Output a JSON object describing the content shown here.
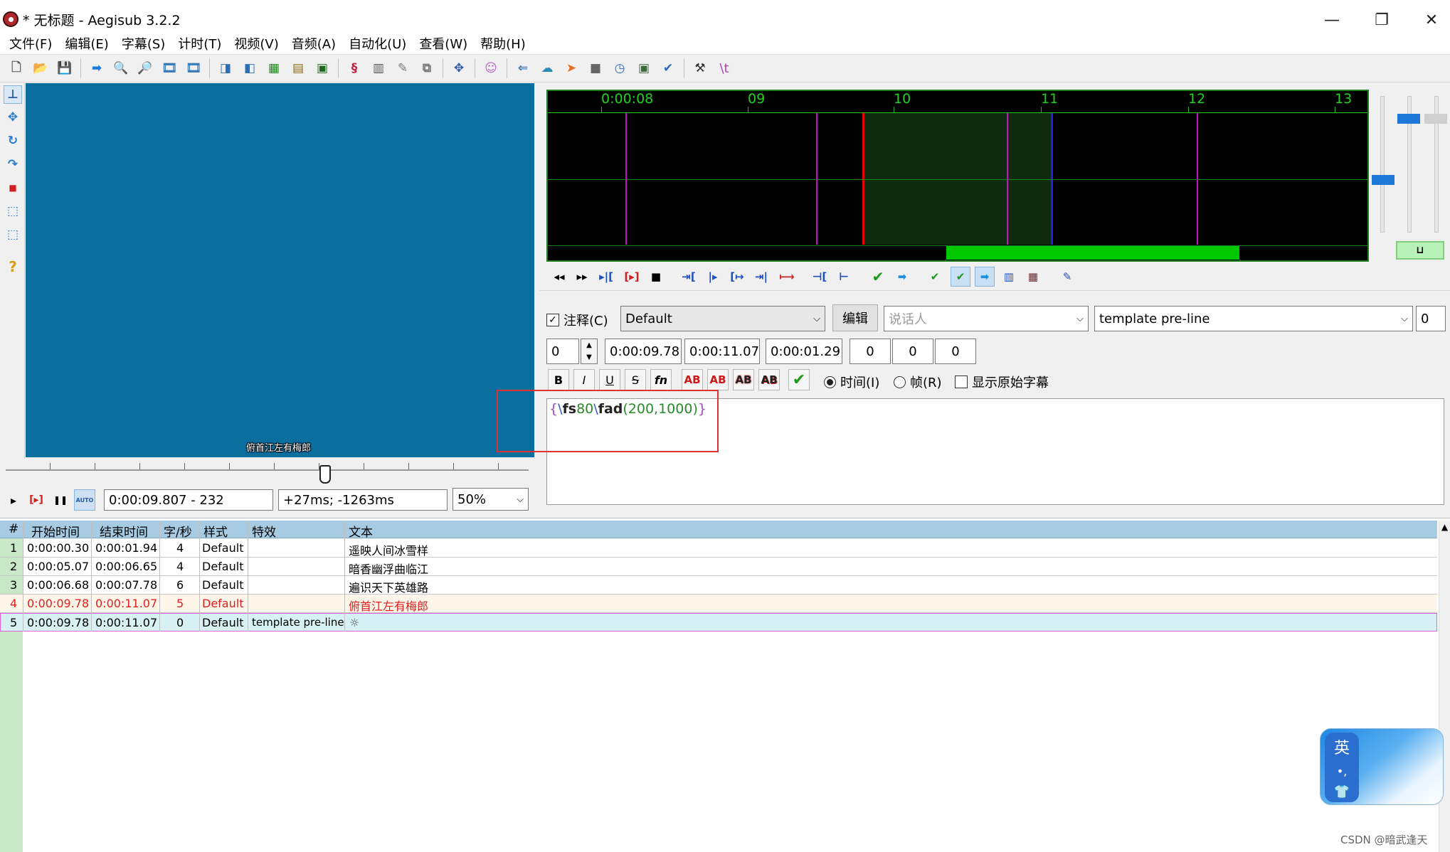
{
  "window": {
    "title": "* 无标题 - Aegisub 3.2.2",
    "minimize_glyph": "—",
    "restore_glyph": "❐",
    "close_glyph": "✕"
  },
  "menu": [
    "文件(F)",
    "编辑(E)",
    "字幕(S)",
    "计时(T)",
    "视频(V)",
    "音频(A)",
    "自动化(U)",
    "查看(W)",
    "帮助(H)"
  ],
  "toolbar": {
    "glyphs": [
      "🗋",
      "📂",
      "💾",
      "➡",
      "🔍",
      "🔎",
      "🎞",
      "🎞",
      "◨",
      "◧",
      "▦",
      "▤",
      "▣",
      "§",
      "▥",
      "✎",
      "⧉",
      "✥",
      "☺",
      "⇐",
      "☁",
      "➤",
      "■",
      "◷",
      "▣",
      "✔",
      "⚒"
    ],
    "last_label": "\\t"
  },
  "vtools": {
    "glyphs": [
      "⊥",
      "✥",
      "↻",
      "↷",
      "■",
      "⬚",
      "⬚",
      "?"
    ]
  },
  "video": {
    "subtitle_text": "俯首江左有梅郎",
    "play_glyph": "▸",
    "play_range_glyph": "[▸]",
    "pause_glyph": "❚❚",
    "auto_label": "AUTO",
    "time_frame": "0:00:09.807 - 232",
    "offset": "+27ms; -1263ms",
    "zoom": "50%"
  },
  "audio": {
    "ruler_labels": [
      "0:00:08",
      "09",
      "10",
      "11",
      "12",
      "13"
    ],
    "controls": [
      "◂◂",
      "▸▸",
      "▸|[",
      "[▸]",
      "■",
      "⇥[",
      "|▸",
      "[↦",
      "⇥|",
      "⟼",
      "⊣[",
      "⊢",
      "✔",
      "➡",
      "✔",
      "✔",
      "➡",
      "▥",
      "▦",
      "✎"
    ]
  },
  "edit": {
    "comment_label": "注释(C)",
    "style": "Default",
    "edit_button": "编辑",
    "actor_placeholder": "说话人",
    "effect": "template pre-line",
    "margin_right_layer": "0",
    "layer": "0",
    "start_time": "0:00:09.78",
    "end_time": "0:00:11.07",
    "duration": "0:00:01.29",
    "margin_l": "0",
    "margin_r": "0",
    "margin_v": "0",
    "fmt_bold": "B",
    "fmt_italic": "I",
    "fmt_underline": "U",
    "fmt_strike": "S",
    "fmt_font": "fn",
    "fmt_color": "AB",
    "commit": "✔",
    "radio_time": "时间(I)",
    "radio_frame": "帧(R)",
    "show_original": "显示原始字幕",
    "text": {
      "brace_open": "{",
      "tag1_slash": "\\",
      "tag1_name": "fs",
      "tag1_value": "80",
      "tag2_slash": "\\",
      "tag2_name": "fad",
      "tag2_args": "(200,1000)",
      "brace_close": "}"
    }
  },
  "grid": {
    "headers": [
      "#",
      "开始时间",
      "结束时间",
      "字/秒",
      "样式",
      "特效",
      "文本"
    ],
    "rows": [
      {
        "n": "1",
        "start": "0:00:00.30",
        "end": "0:00:01.94",
        "cps": "4",
        "style": "Default",
        "effect": "",
        "text": "遥映人间冰雪样"
      },
      {
        "n": "2",
        "start": "0:00:05.07",
        "end": "0:00:06.65",
        "cps": "4",
        "style": "Default",
        "effect": "",
        "text": "暗香幽浮曲临江"
      },
      {
        "n": "3",
        "start": "0:00:06.68",
        "end": "0:00:07.78",
        "cps": "6",
        "style": "Default",
        "effect": "",
        "text": "遍识天下英雄路"
      },
      {
        "n": "4",
        "start": "0:00:09.78",
        "end": "0:00:11.07",
        "cps": "5",
        "style": "Default",
        "effect": "",
        "text": "俯首江左有梅郎"
      },
      {
        "n": "5",
        "start": "0:00:09.78",
        "end": "0:00:11.07",
        "cps": "0",
        "style": "Default",
        "effect": "template pre-line",
        "text": "☼"
      }
    ]
  },
  "ime": {
    "lang": "英",
    "punct": "•,",
    "shirt": "👕"
  },
  "watermark": "CSDN @暗武逢天",
  "colors": {
    "video_bg": "#0a6e9f",
    "audio_bg": "#000000",
    "audio_green": "#22d022",
    "selection_start": "#e00000",
    "selection_end": "#2020e8",
    "keyframe": "#c012c0",
    "row_highlight_text": "#e02020",
    "row_selected_bg": "#d6f0f4"
  }
}
